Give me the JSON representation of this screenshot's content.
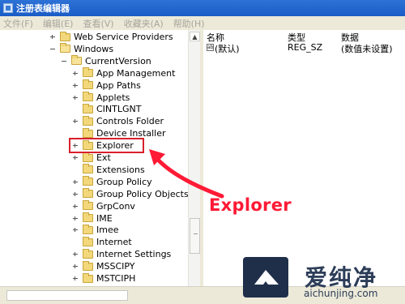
{
  "window": {
    "title": "注册表编辑器"
  },
  "menu": {
    "items": [
      "文件(F)",
      "编辑(E)",
      "查看(V)",
      "收藏夹(A)",
      "帮助(H)"
    ]
  },
  "tree": {
    "items": [
      {
        "label": "Web Service Providers",
        "level": 1,
        "expander": "plus"
      },
      {
        "label": "Windows",
        "level": 1,
        "expander": "minus"
      },
      {
        "label": "CurrentVersion",
        "level": 2,
        "expander": "minus"
      },
      {
        "label": "App Management",
        "level": 3,
        "expander": "plus"
      },
      {
        "label": "App Paths",
        "level": 3,
        "expander": "plus"
      },
      {
        "label": "Applets",
        "level": 3,
        "expander": "plus"
      },
      {
        "label": "CINTLGNT",
        "level": 3,
        "expander": "none"
      },
      {
        "label": "Controls Folder",
        "level": 3,
        "expander": "plus"
      },
      {
        "label": "Device Installer",
        "level": 3,
        "expander": "none"
      },
      {
        "label": "Explorer",
        "level": 3,
        "expander": "plus",
        "highlighted": true
      },
      {
        "label": "Ext",
        "level": 3,
        "expander": "plus"
      },
      {
        "label": "Extensions",
        "level": 3,
        "expander": "none"
      },
      {
        "label": "Group Policy",
        "level": 3,
        "expander": "plus"
      },
      {
        "label": "Group Policy Objects",
        "level": 3,
        "expander": "plus"
      },
      {
        "label": "GrpConv",
        "level": 3,
        "expander": "plus"
      },
      {
        "label": "IME",
        "level": 3,
        "expander": "plus"
      },
      {
        "label": "Imee",
        "level": 3,
        "expander": "plus"
      },
      {
        "label": "Internet",
        "level": 3,
        "expander": "none"
      },
      {
        "label": "Internet Settings",
        "level": 3,
        "expander": "plus"
      },
      {
        "label": "MSSCIPY",
        "level": 3,
        "expander": "plus"
      },
      {
        "label": "MSTCIPH",
        "level": 3,
        "expander": "plus"
      }
    ]
  },
  "list": {
    "headers": {
      "name": "名称",
      "type": "类型",
      "data": "数据"
    },
    "rows": [
      {
        "name": "(默认)",
        "type": "REG_SZ",
        "data": "(数值未设置)"
      }
    ]
  },
  "annotation": {
    "callout_text": "Explorer",
    "accent_color": "#ff1a35"
  },
  "watermark": {
    "text": "爱纯净",
    "url": "aichunjing.com"
  }
}
